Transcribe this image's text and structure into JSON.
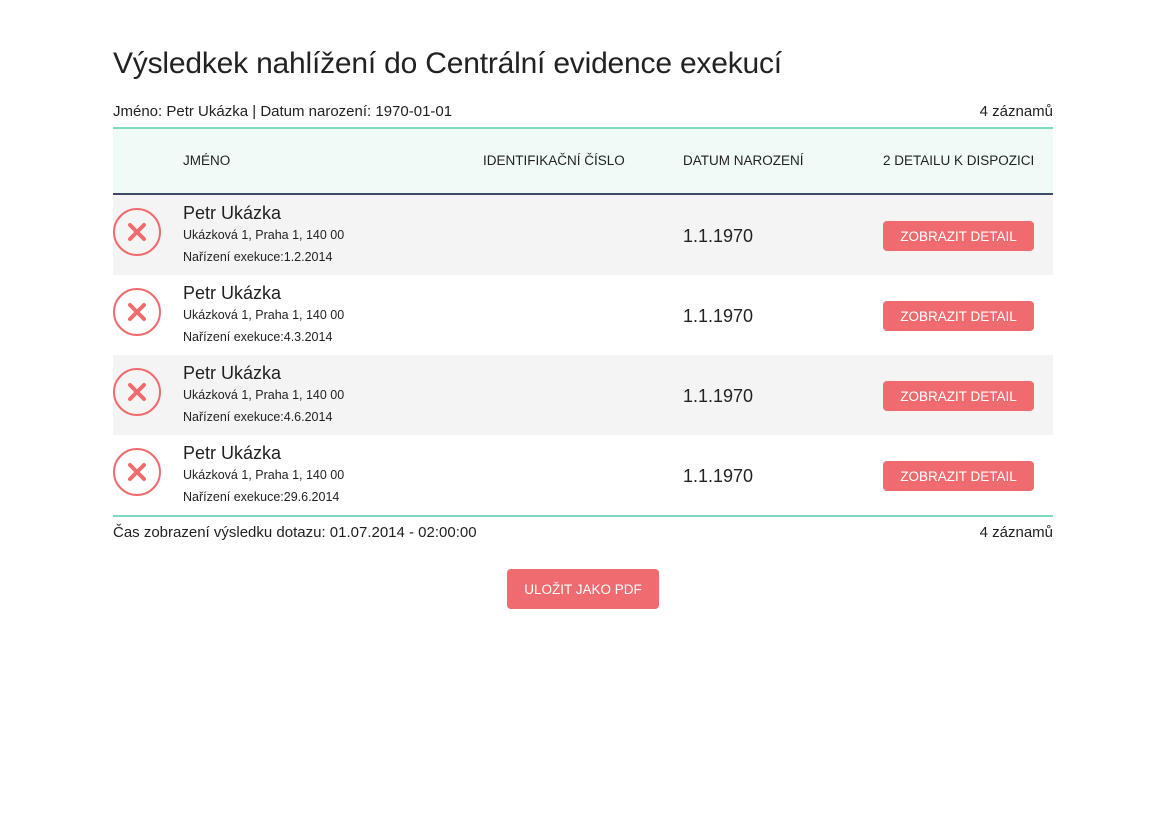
{
  "page": {
    "title": "Výsledkek nahlížení do Centrální evidence exekucí",
    "meta_name": "Jméno: Petr Ukázka",
    "meta_separator": "|",
    "meta_dob": "Datum narození: 1970-01-01",
    "record_count": "4 záznamů"
  },
  "table": {
    "headers": {
      "name": "Jméno",
      "id_number": "Identifikační číslo",
      "dob": "Datum narození",
      "details": "2 detailu k dispozici"
    },
    "rows": [
      {
        "name": "Petr Ukázka",
        "address": "Ukázková 1, Praha 1, 140 00",
        "order": "Nařízení exekuce:1.2.2014",
        "dob": "1.1.1970",
        "button": "Zobrazit detail",
        "status_icon": "cross-icon"
      },
      {
        "name": "Petr Ukázka",
        "address": "Ukázková 1, Praha 1, 140 00",
        "order": "Nařízení exekuce:4.3.2014",
        "dob": "1.1.1970",
        "button": "Zobrazit detail",
        "status_icon": "cross-icon"
      },
      {
        "name": "Petr Ukázka",
        "address": "Ukázková 1, Praha 1, 140 00",
        "order": "Nařízení exekuce:4.6.2014",
        "dob": "1.1.1970",
        "button": "Zobrazit detail",
        "status_icon": "cross-icon"
      },
      {
        "name": "Petr Ukázka",
        "address": "Ukázková 1, Praha 1, 140 00",
        "order": "Nařízení exekuce:29.6.2014",
        "dob": "1.1.1970",
        "button": "Zobrazit detail",
        "status_icon": "cross-icon"
      }
    ]
  },
  "footer": {
    "query_time": "Čas zobrazení výsledku dotazu: 01.07.2014 - 02:00:00",
    "record_count": "4 záznamů"
  },
  "actions": {
    "save_pdf": "Uložit jako PDF"
  },
  "colors": {
    "accent": "#f06b6f",
    "teal_line": "#7fd8c0",
    "header_bg": "#f0fbf7",
    "header_border": "#3d4a66",
    "row_alt": "#f4f4f4"
  }
}
